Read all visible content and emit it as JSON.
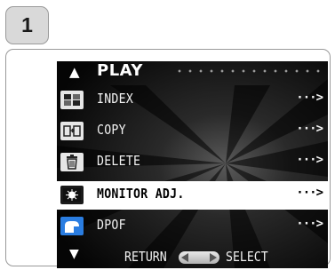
{
  "step": {
    "number": "1"
  },
  "menu": {
    "title": "PLAY",
    "items": [
      {
        "label": "INDEX",
        "arrow": "···>",
        "icon": "index-grid-icon",
        "selected": false
      },
      {
        "label": "COPY",
        "arrow": "···>",
        "icon": "copy-icon",
        "selected": false
      },
      {
        "label": "DELETE",
        "arrow": "···>",
        "icon": "trash-icon",
        "selected": false
      },
      {
        "label": "MONITOR ADJ.",
        "arrow": "···>",
        "icon": "monitor-adjust-icon",
        "selected": true
      },
      {
        "label": "DPOF",
        "arrow": "···>",
        "icon": "print-order-icon",
        "selected": false
      }
    ],
    "footer": {
      "return_label": "RETURN",
      "select_label": "SELECT"
    }
  },
  "colors": {
    "screen_bg": "#050505",
    "highlight": "#ffffff",
    "text": "#f2f2f2"
  }
}
